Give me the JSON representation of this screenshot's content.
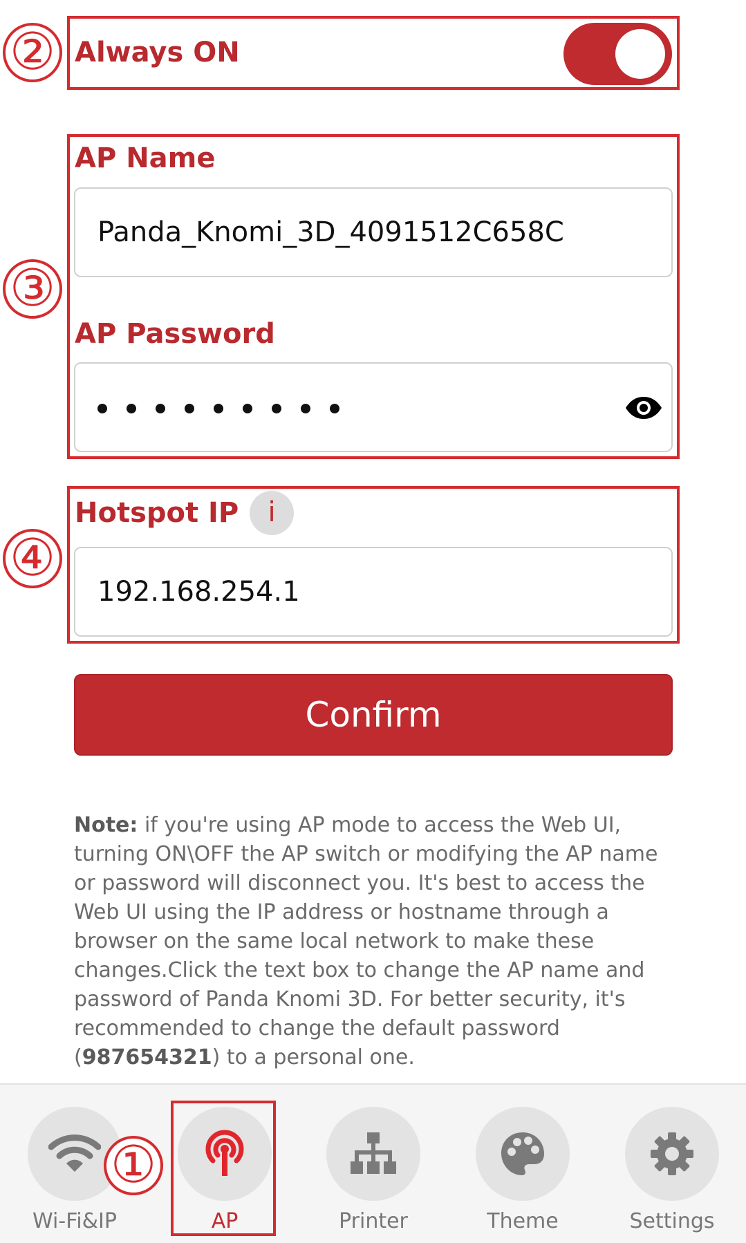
{
  "always_on": {
    "label": "Always ON",
    "enabled": true
  },
  "ap_name": {
    "label": "AP Name",
    "value": "Panda_Knomi_3D_4091512C658C"
  },
  "ap_password": {
    "label": "AP Password",
    "masked_length": 9
  },
  "hotspot_ip": {
    "label": "Hotspot IP",
    "info_glyph": "i",
    "value": "192.168.254.1"
  },
  "confirm_label": "Confirm",
  "note": {
    "bold_prefix": "Note:",
    "text_before_password": " if you're using AP mode to access the Web UI, turning ON\\OFF the AP switch or modifying the AP name or password will disconnect you. It's best to access the Web UI using the IP address or hostname through a browser on the same local network to make these changes.Click the text box to change the AP name and password of Panda Knomi 3D. For better security, it's recommended to change the default password (",
    "default_password": "987654321",
    "text_after_password": ") to a personal one."
  },
  "annotations": [
    "①",
    "②",
    "③",
    "④"
  ],
  "nav": {
    "items": [
      {
        "label": "Wi-Fi&IP",
        "icon": "wifi-icon",
        "active": false
      },
      {
        "label": "AP",
        "icon": "broadcast-antenna-icon",
        "active": true
      },
      {
        "label": "Printer",
        "icon": "network-tree-icon",
        "active": false
      },
      {
        "label": "Theme",
        "icon": "palette-icon",
        "active": false
      },
      {
        "label": "Settings",
        "icon": "gear-icon",
        "active": false
      }
    ]
  },
  "colors": {
    "accent": "#c02b30",
    "annotation": "#d52b2f",
    "nav_inactive_icon": "#777777",
    "nav_circle": "#e3e3e3"
  }
}
